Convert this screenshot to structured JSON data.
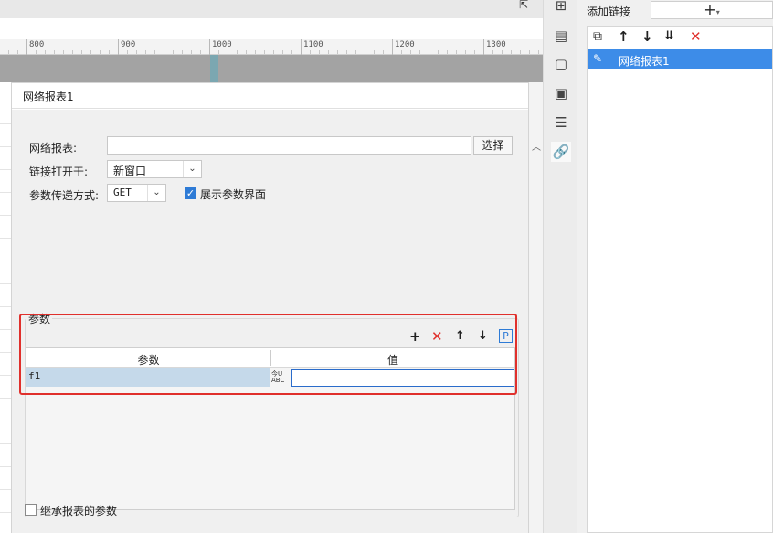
{
  "ruler": {
    "labels": [
      "800",
      "900",
      "1000",
      "1100",
      "1200",
      "1300"
    ]
  },
  "dialog": {
    "title": "网络报表1",
    "report_label": "网络报表:",
    "report_value": "",
    "select_button": "选择",
    "open_in_label": "链接打开于:",
    "open_in_value": "新窗口",
    "method_label": "参数传递方式:",
    "method_value": "GET",
    "show_params_label": "展示参数界面",
    "show_params_checked": true,
    "params_group_title": "参数",
    "params_table": {
      "columns": [
        "参数",
        "值"
      ],
      "rows": [
        {
          "name": "f1",
          "value": ""
        }
      ],
      "type_icon_text": [
        "今U",
        "ABC"
      ]
    },
    "inherit_label": "继承报表的参数",
    "inherit_checked": false
  },
  "param_tools": [
    "add-icon",
    "delete-icon",
    "move-up-icon",
    "move-down-icon",
    "parameter-icon"
  ],
  "param_tool_glyphs": {
    "add": "+",
    "delete": "✕",
    "up": "🡑",
    "down": "🡓",
    "param": "P"
  },
  "vtoolbar": [
    "cell-element-icon",
    "cell-attribute-icon",
    "border-icon",
    "widget-icon",
    "condition-icon",
    "hyperlink-icon"
  ],
  "panel": {
    "title": "添加链接",
    "add_symbol": "+",
    "items": [
      {
        "label": "网络报表1",
        "selected": true
      }
    ]
  },
  "colors": {
    "accent": "#3d8ce8",
    "delete": "#e0302c",
    "highlight_box": "#e0302c"
  }
}
